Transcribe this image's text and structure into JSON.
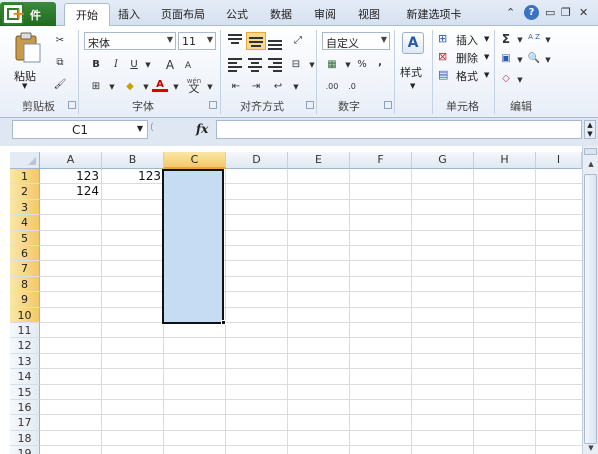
{
  "tabs": {
    "file": "件",
    "items": [
      "开始",
      "插入",
      "页面布局",
      "公式",
      "数据",
      "审阅",
      "视图",
      "新建选项卡"
    ],
    "active": "开始"
  },
  "ribbon": {
    "clipboard": {
      "paste": "粘贴",
      "label": "剪贴板"
    },
    "font": {
      "name": "宋体",
      "size": "11",
      "bold": "B",
      "italic": "I",
      "underline": "U",
      "grow": "A",
      "shrink": "A",
      "color": "A",
      "wen": "wén",
      "wen_char": "文",
      "label": "字体"
    },
    "alignment": {
      "label": "对齐方式"
    },
    "number": {
      "format": "自定义",
      "percent": "%",
      "comma": ",",
      "inc": ".00",
      "label": "数字"
    },
    "styles": {
      "label": "样式"
    },
    "cells": {
      "insert": "插入",
      "delete": "删除",
      "format": "格式",
      "label": "单元格"
    },
    "editing": {
      "sum": "Σ",
      "sort": "A Z",
      "label": "编辑"
    }
  },
  "formula_bar": {
    "name_box": "C1",
    "fx": "fx",
    "value": ""
  },
  "grid": {
    "columns": [
      "A",
      "B",
      "C",
      "D",
      "E",
      "F",
      "G",
      "H",
      "I"
    ],
    "rows": [
      "1",
      "2",
      "3",
      "4",
      "5",
      "6",
      "7",
      "8",
      "9",
      "10",
      "11",
      "12",
      "13",
      "14",
      "15",
      "16",
      "17",
      "18",
      "19"
    ],
    "selected_column": "C",
    "selected_range": "C1:C10",
    "cells": {
      "A1": "123",
      "B1": "123",
      "A2": "124"
    }
  },
  "colors": {
    "accent": "#2f7f2f",
    "selection": "#c5dcf3",
    "header_highlight": "#f3c86a"
  }
}
